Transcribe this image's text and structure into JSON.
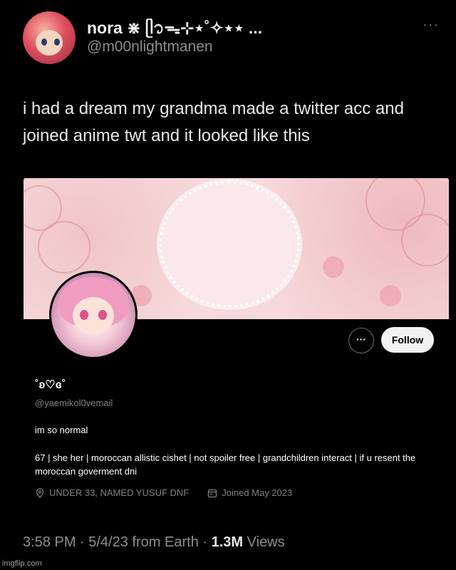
{
  "tweet": {
    "display_name": "nora ⋇ ᥫ᭡ᯓ⊹⋆˚✧⋆⋆ ...",
    "handle": "@m00nlightmanen",
    "more_label": "···",
    "text": "i had a dream my grandma made a twitter acc and joined anime twt and it looked like this",
    "time": "3:58 PM",
    "date": "5/4/23",
    "from": "from Earth",
    "views_count": "1.3M",
    "views_label": "Views",
    "sep": "·"
  },
  "profile_card": {
    "more_label": "···",
    "follow_label": "Follow",
    "name": "˚ʚ♡ɞ˚",
    "handle": "@yaemikol0vemail",
    "bio_line1": "im so normal",
    "bio_line2": "67 | she her | moroccan allistic cishet | not spoiler free | grandchildren interact | if u resent the moroccan goverment dni",
    "location": "UNDER 33, NAMED YUSUF DNF",
    "joined": "Joined May 2023"
  },
  "watermark": "imgflip.com"
}
